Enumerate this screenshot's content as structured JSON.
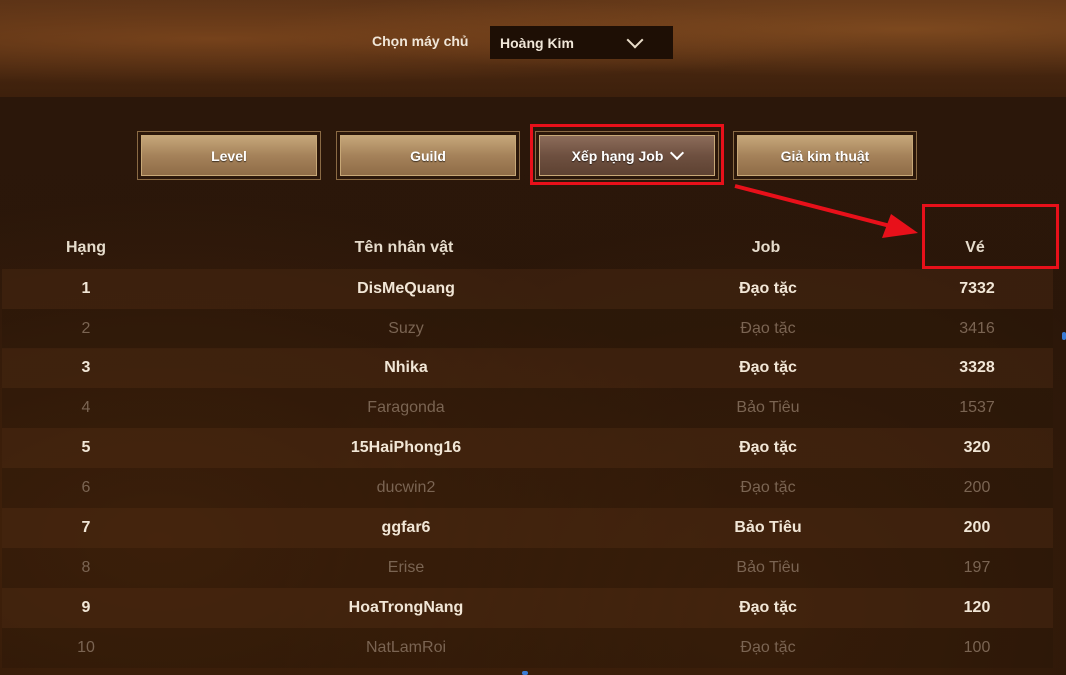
{
  "header": {
    "server_label": "Chọn máy chủ",
    "server_value": "Hoàng Kim"
  },
  "tabs": [
    {
      "label": "Level"
    },
    {
      "label": "Guild"
    },
    {
      "label": "Xếp hạng Job",
      "active": true
    },
    {
      "label": "Giả kim thuật"
    }
  ],
  "table": {
    "columns": [
      "Hạng",
      "Tên nhân vật",
      "Job",
      "Vé"
    ],
    "rows": [
      {
        "rank": "1",
        "name": "DisMeQuang",
        "job": "Đạo tặc",
        "ticket": "7332"
      },
      {
        "rank": "2",
        "name": "Suzy",
        "job": "Đạo tặc",
        "ticket": "3416"
      },
      {
        "rank": "3",
        "name": "Nhika",
        "job": "Đạo tặc",
        "ticket": "3328"
      },
      {
        "rank": "4",
        "name": "Faragonda",
        "job": "Bảo Tiêu",
        "ticket": "1537"
      },
      {
        "rank": "5",
        "name": "15HaiPhong16",
        "job": "Đạo tặc",
        "ticket": "320"
      },
      {
        "rank": "6",
        "name": "ducwin2",
        "job": "Đạo tặc",
        "ticket": "200"
      },
      {
        "rank": "7",
        "name": "ggfar6",
        "job": "Bảo Tiêu",
        "ticket": "200"
      },
      {
        "rank": "8",
        "name": "Erise",
        "job": "Bảo Tiêu",
        "ticket": "197"
      },
      {
        "rank": "9",
        "name": "HoaTrongNang",
        "job": "Đạo tặc",
        "ticket": "120"
      },
      {
        "rank": "10",
        "name": "NatLamRoi",
        "job": "Đạo tặc",
        "ticket": "100"
      }
    ]
  },
  "colors": {
    "highlight": "#e8101a",
    "tab_gold": "#a5825a",
    "tab_active": "#6e5040"
  }
}
